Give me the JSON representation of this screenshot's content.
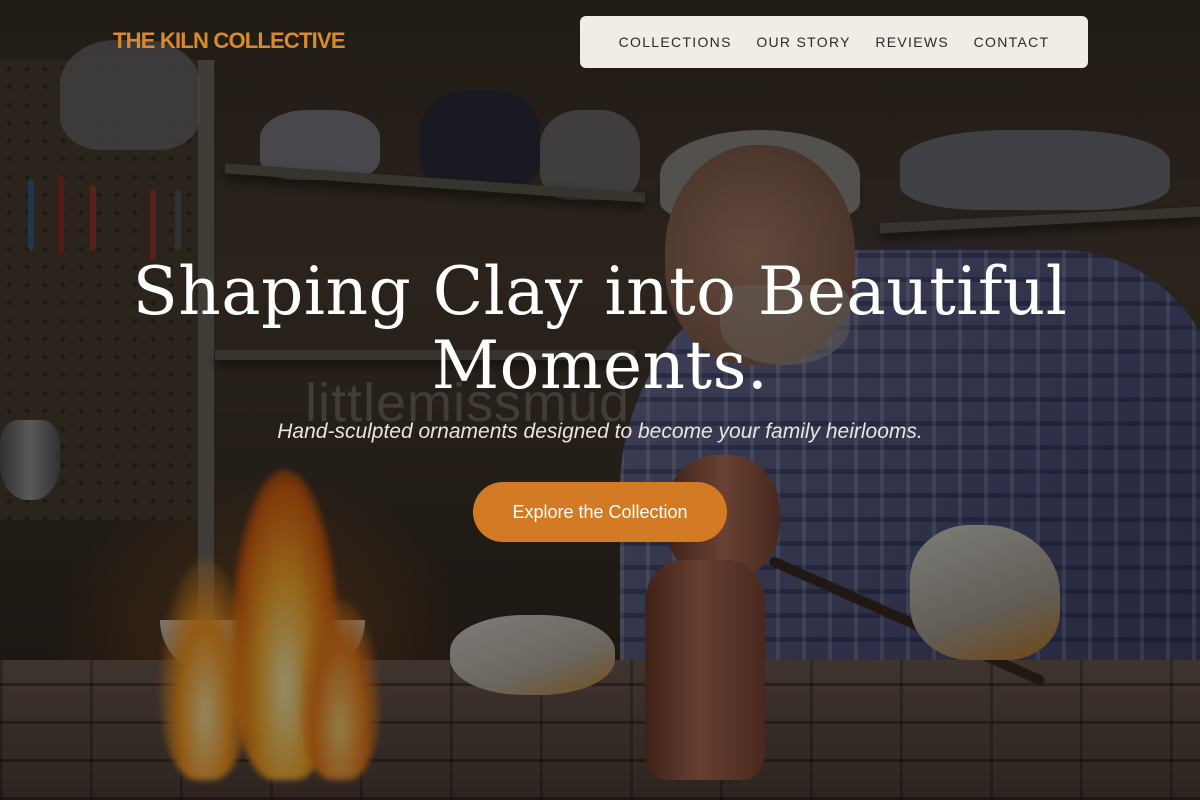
{
  "brand": {
    "name": "THE KILN COLLECTIVE"
  },
  "nav": {
    "items": [
      {
        "label": "COLLECTIONS"
      },
      {
        "label": "OUR STORY"
      },
      {
        "label": "REVIEWS"
      },
      {
        "label": "CONTACT"
      }
    ]
  },
  "hero": {
    "title_line1": "Shaping Clay into Beautiful",
    "title_line2": "Moments.",
    "subtitle": "Hand-sculpted ornaments designed to become your family heirlooms.",
    "cta_label": "Explore the Collection",
    "watermark": "littlemissmud"
  },
  "colors": {
    "accent": "#d37b24",
    "brand_text": "#d98a2b",
    "nav_background": "#f1ede6"
  }
}
